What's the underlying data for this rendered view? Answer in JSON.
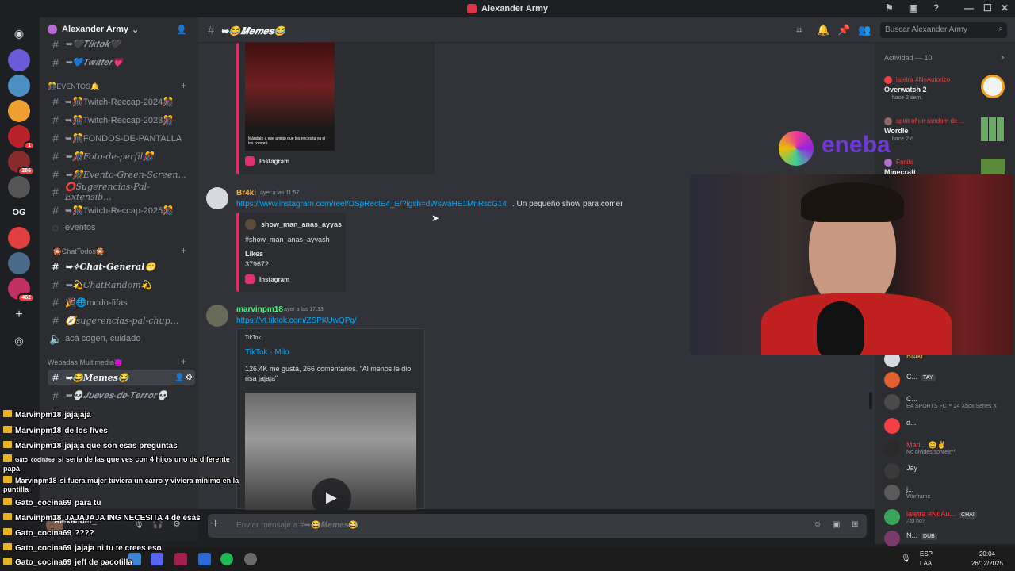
{
  "window": {
    "title": "Alexander Army"
  },
  "rail": {
    "badges": [
      "1",
      "256",
      "462"
    ],
    "og_label": "OG"
  },
  "server": {
    "name": "Alexander Army"
  },
  "channels": [
    {
      "label": "➥🖤𝑻𝒊𝒌𝒕𝒐𝒌🖤",
      "type": "text"
    },
    {
      "label": "➥💙𝑻𝒘𝒊𝒕𝒕𝒆𝒓💗",
      "type": "text"
    }
  ],
  "categories": {
    "eventos": "🎊EVENTOS🔔",
    "chat_todos": "⠀🎇ChatTodos🎇⠀",
    "webadas": "Webadas Multimedia😈"
  },
  "eventos_channels": [
    "➥🎊Twitch-Reccap-2024🎊",
    "➥🎊Twitch-Reccap-2023🎊",
    "➥🎊FONDOS-DE-PANTALLA",
    "➥🎊Foto-de-perfil🎊",
    "➥🎊Evento-Green-Screen...",
    "⭕Sugerencias-Pal-Extensib...",
    "➥🎊Twitch-Reccap-2025🎊",
    "eventos"
  ],
  "chat_channels": [
    "➥✧Chat-General😁",
    "➥💫ChatRandom💫",
    "🎉🌐modo-fifas",
    "🧭sugerencias-pal-chup...",
    "acá cogen, cuidado"
  ],
  "multimedia_channels": [
    "➥😂𝑴𝒆𝒎𝒆𝒔😂",
    "➥💀𝑱𝒖𝒆𝒗𝒆𝒔-𝒅𝒆-𝑻𝒆𝒓𝒓𝒐𝒓💀"
  ],
  "user_panel": {
    "name": "Alexander_"
  },
  "header": {
    "channel": "➥😂𝑴𝒆𝒎𝒆𝒔😂",
    "search_placeholder": "Buscar Alexander Army"
  },
  "messages": [
    {
      "embed_caption": "Mándalo a ese amigo que los necesita ya el las compró",
      "provider": "Instagram"
    },
    {
      "author": "Br4ki",
      "author_color": "#f0b232",
      "timestamp": "ayer a las 11:57",
      "link": "https://www.instagram.com/reel/DSpRectE4_E/?igsh=dWswaHE1MnRscG14",
      "text": ". Un pequeño show para comer",
      "embed_author": "show_man_anas_ayyas",
      "embed_desc": "#show_man_anas_ayyash",
      "embed_field_name": "Likes",
      "embed_field_value": "379672",
      "provider": "Instagram"
    },
    {
      "author": "marvinpm18",
      "author_color": "#57f287",
      "timestamp": "ayer a las 17:13",
      "link": "https://vt.tiktok.com/ZSPKUwQPg/",
      "embed_provider": "TikTok",
      "embed_title": "TikTok · Milo",
      "embed_desc": "126.4K me gusta, 266 comentarios. \"Al menos le dio risa jajaja\""
    }
  ],
  "composer": {
    "placeholder": "Enviar mensaje a #➥😂𝑴𝒆𝒎𝒆𝒔😂"
  },
  "activity": {
    "header": "Actividad — 10",
    "items": [
      {
        "user": "laletra #NoAutorizo",
        "game": "Overwatch 2",
        "sub": "hace 2 sem."
      },
      {
        "user": "spirit of un random de ...",
        "game": "Wordle",
        "sub": "hace 2 d"
      },
      {
        "user": "Fanita",
        "game": "Minecraft",
        "sub": ""
      }
    ]
  },
  "members": [
    {
      "name": "Br4ki",
      "status": "",
      "tag": ""
    },
    {
      "name": "C...",
      "status": "",
      "tag": "TAY"
    },
    {
      "name": "C...",
      "status": "EA SPORTS FC™ 24 Xbox Series X",
      "tag": ""
    },
    {
      "name": "d...",
      "status": "",
      "tag": ""
    },
    {
      "name": "Mari... 😄✌",
      "status": "No olvides sonreír^^",
      "tag": ""
    },
    {
      "name": "Jay",
      "status": "",
      "tag": ""
    },
    {
      "name": "j...",
      "status": "Warframe",
      "tag": ""
    },
    {
      "name": "laletra #NoAu...",
      "status": "¿tú no?",
      "tag": "CHAI"
    },
    {
      "name": "N...",
      "status": "",
      "tag": "DUB"
    }
  ],
  "overlay_brand": "eneba",
  "stream_chat": [
    {
      "user": "Marvinpm18",
      "text": "jajajaja"
    },
    {
      "user": "Marvinpm18",
      "text": "de los fives"
    },
    {
      "user": "Marvinpm18",
      "text": "jajaja que son esas preguntas"
    },
    {
      "user": "Gato_cocina69",
      "text": "si sería de las que ves con 4 hijos uno de diferente papá"
    },
    {
      "user": "Marvinpm18",
      "text": "si fuera mujer tuviera un carro y viviera mínimo en la puntilla"
    },
    {
      "user": "Gato_cocina69",
      "text": "para tu"
    },
    {
      "user": "Marvinpm18",
      "text": "JAJAJAJA ING NECESITA 4 de esas"
    },
    {
      "user": "Gato_cocina69",
      "text": "????"
    },
    {
      "user": "Gato_cocina69",
      "text": "jajaja ni tu te crees eso"
    },
    {
      "user": "Gato_cocina69",
      "text": "jeff de pacotilla"
    }
  ],
  "taskbar": {
    "lang": "ESP",
    "layout": "LAA",
    "time": "20:04",
    "date": "26/12/2025"
  },
  "colors": {
    "accent": "#5865f2",
    "link": "#00a8fc",
    "instagram": "#e1306c"
  }
}
